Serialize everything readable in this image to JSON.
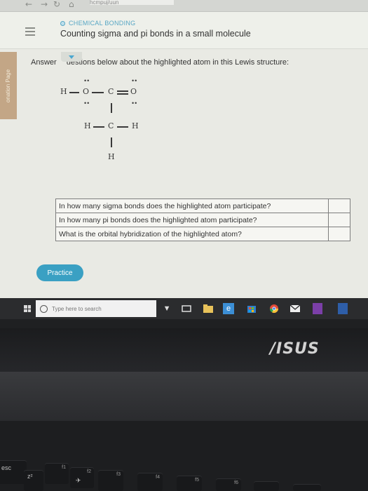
{
  "browser": {
    "back": "←",
    "forward": "→",
    "refresh": "↻",
    "home": "⌂",
    "url": "hcmpuj/uun"
  },
  "header": {
    "topic": "CHEMICAL BONDING",
    "title": "Counting sigma and pi bonds in a small molecule"
  },
  "side_tab": {
    "label": "onation Page"
  },
  "prompt": {
    "text": "Answer      uestions below about the highlighted atom in this Lewis structure:"
  },
  "lewis": {
    "atoms": [
      "H",
      "O",
      "C",
      "O",
      "H",
      "C",
      "H",
      "H"
    ],
    "lone_pairs": "••"
  },
  "questions": [
    {
      "text": "In how many sigma bonds does the highlighted atom participate?",
      "answer": ""
    },
    {
      "text": "In how many pi bonds does the highlighted atom participate?",
      "answer": ""
    },
    {
      "text": "What is the orbital hybridization of the highlighted atom?",
      "answer": ""
    }
  ],
  "practice_button": {
    "label": "Practice"
  },
  "taskbar": {
    "search_placeholder": "Type here to search",
    "icons": [
      "microphone-icon",
      "task-view-icon",
      "file-explorer-icon",
      "edge-icon",
      "store-icon",
      "chrome-icon",
      "mail-icon",
      "onenote-icon",
      "word-icon"
    ]
  },
  "laptop": {
    "brand": "/ISUS"
  },
  "keyboard": {
    "esc": "esc",
    "f1": "f1",
    "f2": "f2",
    "f3": "f3",
    "f4": "f4",
    "f5": "f5",
    "f6": "f6",
    "z2": "z²"
  }
}
